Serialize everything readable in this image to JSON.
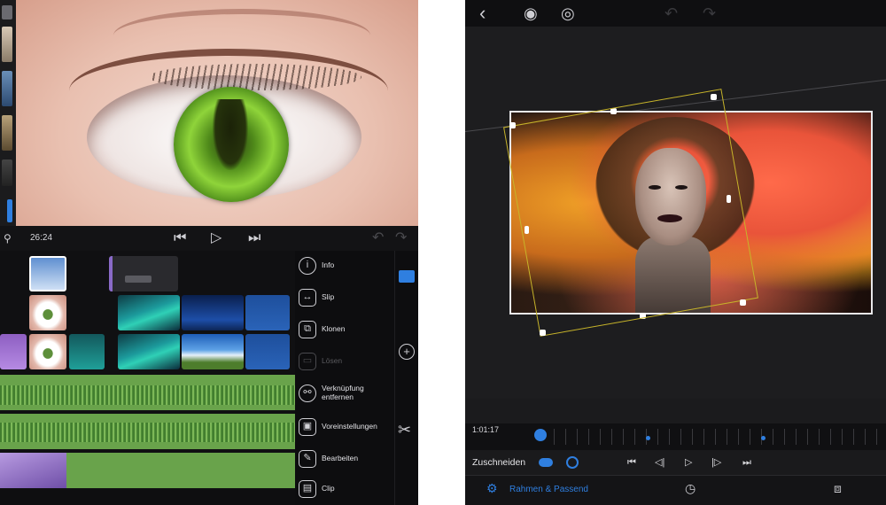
{
  "left_app": {
    "transport": {
      "timecode": "26:24"
    },
    "timeline": {
      "audio_tracks": [
        {
          "label": ""
        },
        {
          "label": ""
        },
        {
          "label": ""
        }
      ]
    },
    "menu": {
      "items": [
        {
          "label": "Info",
          "icon": "info-icon",
          "enabled": true
        },
        {
          "label": "Slip",
          "icon": "slip-icon",
          "enabled": true
        },
        {
          "label": "Klonen",
          "icon": "clone-icon",
          "enabled": true
        },
        {
          "label": "Lösen",
          "icon": "detach-icon",
          "enabled": false
        },
        {
          "label": "Verknüpfung entfernen",
          "icon": "unlink-icon",
          "enabled": true
        },
        {
          "label": "Voreinstellungen",
          "icon": "presets-icon",
          "enabled": true
        },
        {
          "label": "Bearbeiten",
          "icon": "edit-icon",
          "enabled": true
        },
        {
          "label": "Clip",
          "icon": "clip-icon",
          "enabled": true
        }
      ]
    }
  },
  "right_app": {
    "scrubber": {
      "timecode": "1:01:17"
    },
    "controls": {
      "crop_label": "Zuschneiden"
    },
    "tabs": {
      "active_label": "Rahmen & Passend"
    },
    "colors": {
      "accent": "#2f7fe0",
      "selection": "#c7b42a"
    }
  }
}
